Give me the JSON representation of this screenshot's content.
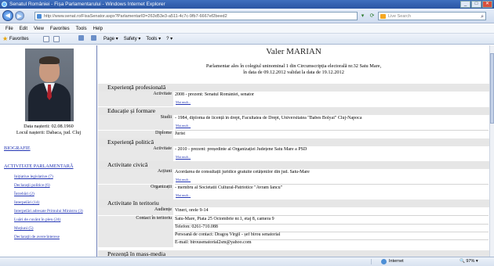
{
  "window": {
    "title": "Senatul României - Fișa Parlamentarului - Windows Internet Explorer",
    "min": "_",
    "max": "□",
    "close": "✕"
  },
  "toolbar": {
    "url": "http://www.senat.ro/FisaSenator.aspx?ParlamentarID=263d53e3-a511-4c7c-9fb7-6667ef2beed2",
    "search_placeholder": "Live Search",
    "back_icon": "back-arrow-icon",
    "forward_icon": "forward-arrow-icon"
  },
  "menu": [
    "File",
    "Edit",
    "View",
    "Favorites",
    "Tools",
    "Help"
  ],
  "favbar": {
    "favorites": "Favorites",
    "page": "Page ▾",
    "safety": "Safety ▾",
    "tools": "Tools ▾",
    "help": "? ▾"
  },
  "sidebar": {
    "birth_date": "Data nașterii: 02.08.1960",
    "birth_place": "Locul nașterii: Dabaca, jud. Cluj",
    "bio_link": "BIOGRAFIE",
    "activity_link": "ACTIVITATE PARLAMENTARĂ",
    "activity_items": [
      "Inițiative legislative (7)",
      "Declarații politice (6)",
      "Întrebări (2)",
      "Interpelări (14)",
      "Interpelări adresate Primului Ministru (3)",
      "Luări de cuvânt în plen (24)",
      "Moțiuni (5)",
      "Declarații de avere/interese"
    ]
  },
  "main": {
    "name": "Valer MARIAN",
    "intro_1": "Parlamentar ales în colegiul uninominal 1 din Circumscripția electorală nr.32 Satu Mare,",
    "intro_2": "în data de 09.12.2012 validat la data de 19.12.2012",
    "more": "Mai mult...",
    "sections": {
      "exp_prof": "Experiență profesională",
      "edu": "Educație și formare",
      "exp_pol": "Experiență politică",
      "civic": "Activitate civică",
      "territory": "Activitate în teritoriu",
      "media": "Prezență în mass-media"
    },
    "rows": {
      "activity_label": "Activitate",
      "exp_prof_val": "2008 - prezent: Senatul României, senator",
      "studies_label": "Studii",
      "studies_val": "- 1984, diploma de licență în drept, Facultatea de Drept, Universitatea \"Babes Bolyai\" Cluj-Napoca",
      "diplomas_label": "Diplome",
      "diplomas_val": "Jurist",
      "exp_pol_val": "- 2010 - prezent: președinte al Organizației Județene Satu Mare a PSD",
      "actions_label": "Acțiuni",
      "actions_val": "Acordarea de consultații juridice gratuite cetățenilor din jud. Satu-Mare",
      "orgs_label": "Organizații",
      "orgs_val": "- membru al Societatii Cultural-Patriotice \"Avram Iancu\"",
      "audience_label": "Audiențe",
      "audience_val": "Vineri, orele 9-14",
      "contact_label": "Contact în teritoriu",
      "contact_1": "Satu-Mare, Piata 25 Octombrie nr.1, etaj 8, camera 9",
      "contact_2": "Telefon: 0261-710.088",
      "contact_3": "Persoană de contact: Dragoș Virgil - șef birou senatorial",
      "contact_4": "E-mail: birousenatorial2sm@yahoo.com"
    }
  },
  "status": {
    "zone": "Internet",
    "zoom": "🔍 97% ▾"
  }
}
